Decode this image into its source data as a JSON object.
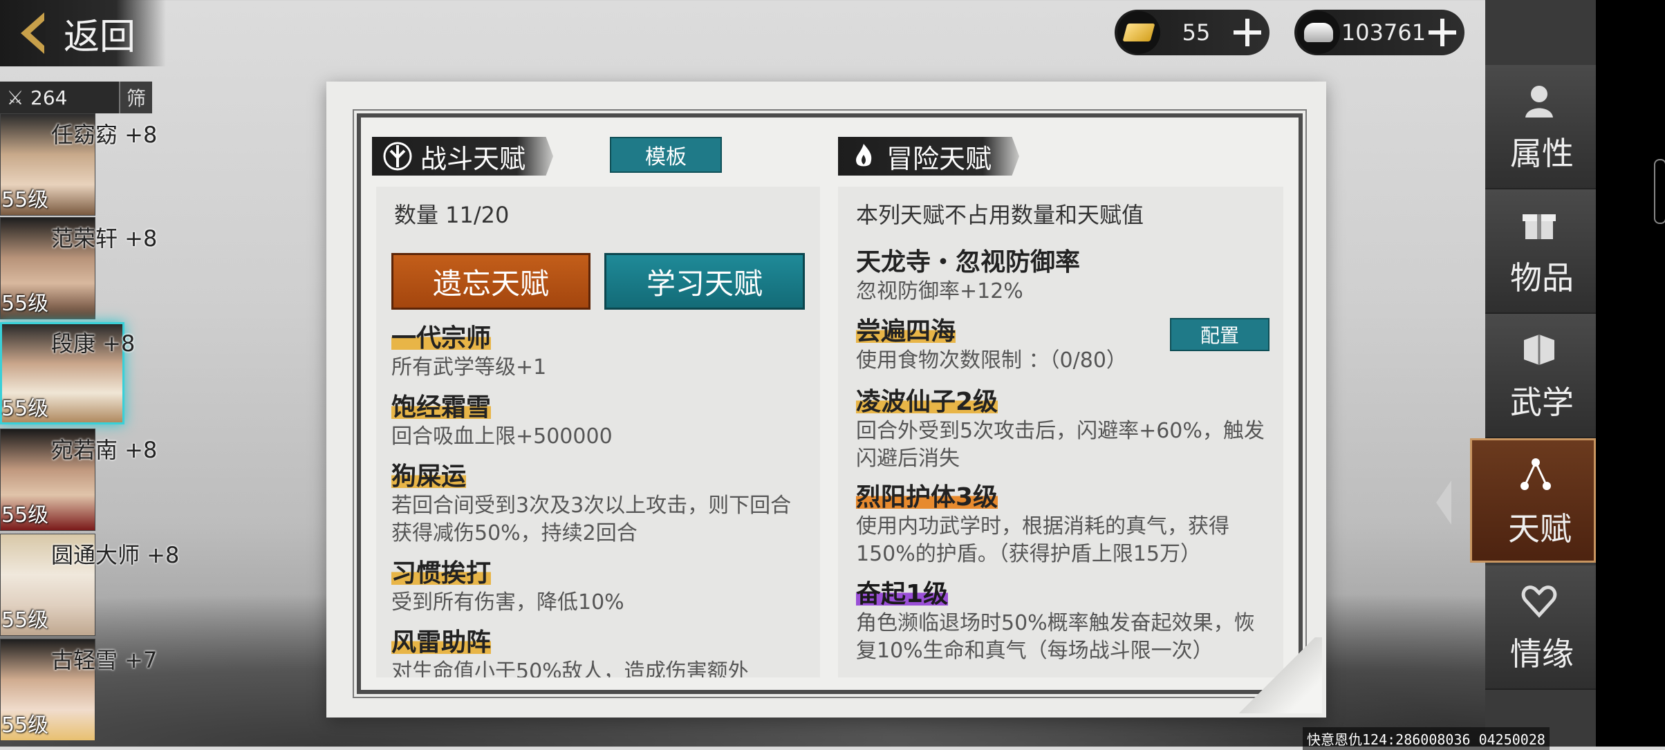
{
  "header": {
    "back_label": "返回"
  },
  "currency": {
    "gold": {
      "value": "55",
      "icon": "gold-ingot-icon"
    },
    "silver": {
      "value": "103761",
      "icon": "silver-ingot-icon"
    }
  },
  "hero_list": {
    "count": "264",
    "filter_label": "筛",
    "heroes": [
      {
        "name": "任窈窈 +8",
        "level": "55级"
      },
      {
        "name": "范荣轩 +8",
        "level": "55级"
      },
      {
        "name": "段康 +8",
        "level": "55级"
      },
      {
        "name": "宛若南 +8",
        "level": "55级"
      },
      {
        "name": "圆通大师 +8",
        "level": "55级"
      },
      {
        "name": "古轻雪 +7",
        "level": "55级"
      }
    ]
  },
  "combat": {
    "title": "战斗天赋",
    "template_label": "模板",
    "count_label": "数量 11/20",
    "forget_label": "遗忘天赋",
    "learn_label": "学习天赋",
    "talents": [
      {
        "title": "一代宗师",
        "desc": "所有武学等级+1"
      },
      {
        "title": "饱经霜雪",
        "desc": "回合吸血上限+500000"
      },
      {
        "title": "狗屎运",
        "desc": "若回合间受到3次及3次以上攻击，则下回合获得减伤50%，持续2回合"
      },
      {
        "title": "习惯挨打",
        "desc": "受到所有伤害，降低10%"
      },
      {
        "title": "风雷助阵",
        "desc": "对生命值小于50%敌人，造成伤害额外"
      }
    ]
  },
  "adventure": {
    "title": "冒险天赋",
    "note": "本列天赋不占用数量和天赋值",
    "config_label": "配置",
    "talents": [
      {
        "title": "天龙寺・忽视防御率",
        "desc": "忽视防御率+12%"
      },
      {
        "title": "尝遍四海",
        "desc": "使用食物次数限制 ：（0/80）"
      },
      {
        "title": "凌波仙子2级",
        "desc": "回合外受到5次攻击后，闪避率+60%，触发闪避后消失"
      },
      {
        "title": "烈阳护体3级",
        "desc": "使用内功武学时，根据消耗的真气，获得150%的护盾。（获得护盾上限15万）"
      },
      {
        "title": "奋起1级",
        "desc": "角色濒临退场时50%概率触发奋起效果，恢复10%生命和真气（每场战斗限一次）"
      }
    ]
  },
  "side_nav": [
    {
      "label": "属性",
      "icon": "person-icon"
    },
    {
      "label": "物品",
      "icon": "gift-box-icon"
    },
    {
      "label": "武学",
      "icon": "book-icon"
    },
    {
      "label": "天赋",
      "icon": "talent-tree-icon"
    },
    {
      "label": "情缘",
      "icon": "heart-icon"
    }
  ],
  "footer": {
    "text": "快意恩仇124:286008036 04250028"
  }
}
